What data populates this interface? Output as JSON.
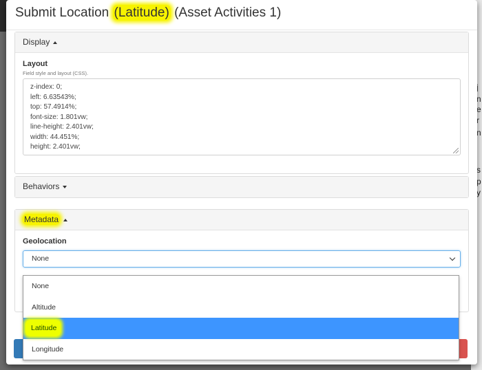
{
  "modal": {
    "title_prefix": "Submit Location ",
    "title_highlight": "(Latitude)",
    "title_suffix": " (Asset Activities 1)"
  },
  "display_panel": {
    "heading": "Display",
    "layout_label": "Layout",
    "layout_help": "Field style and layout (CSS).",
    "css_lines": [
      "z-index: 0;",
      "left: 6.63543%;",
      "top: 57.4914%;",
      "font-size: 1.801vw;",
      "line-height: 2.401vw;",
      "width: 44.451%;",
      "height: 2.401vw;"
    ]
  },
  "behaviors_panel": {
    "heading": "Behaviors"
  },
  "metadata_panel": {
    "heading": "Metadata",
    "geolocation_label": "Geolocation",
    "selected_value": "None",
    "options": [
      "None",
      "Altitude",
      "Latitude",
      "Longitude"
    ],
    "highlighted_option": "Latitude"
  },
  "background": {
    "right_edge_glyphs": [
      "j",
      "n",
      "e",
      "r",
      "n",
      "s",
      "p",
      "y"
    ]
  },
  "colors": {
    "highlight": "#f7f300",
    "selected_option": "#3d95ff",
    "primary": "#337ab7",
    "danger": "#d9534f"
  }
}
